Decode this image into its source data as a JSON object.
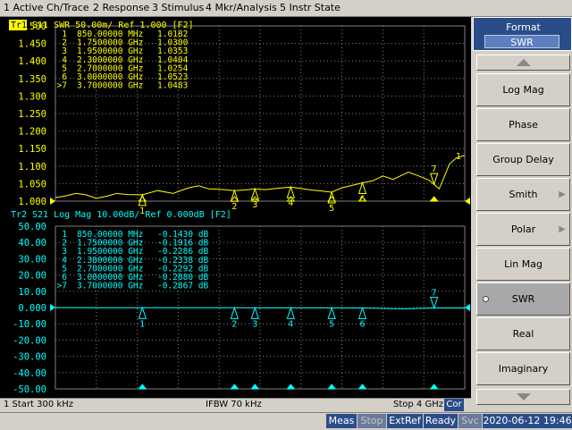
{
  "menu": [
    "1 Active Ch/Trace",
    "2 Response",
    "3 Stimulus",
    "4 Mkr/Analysis",
    "5 Instr State"
  ],
  "colors": {
    "trace1": "#ffff00",
    "trace2": "#00ffff",
    "grid": "#808080",
    "marker": "#ffff00"
  },
  "trace1": {
    "tag": "Tr1",
    "header": "S11  SWR 50.00m/ Ref 1.000 [F2]",
    "yticks": [
      "1.500",
      "1.450",
      "1.400",
      "1.350",
      "1.300",
      "1.250",
      "1.200",
      "1.150",
      "1.100",
      "1.050",
      "1.000"
    ],
    "markers": [
      {
        "id": "1",
        "freq": "850.00000 MHz",
        "val": "1.0182"
      },
      {
        "id": "2",
        "freq": "1.7500000 GHz",
        "val": "1.0300"
      },
      {
        "id": "3",
        "freq": "1.9500000 GHz",
        "val": "1.0353"
      },
      {
        "id": "4",
        "freq": "2.3000000 GHz",
        "val": "1.0404"
      },
      {
        "id": "5",
        "freq": "2.7000000 GHz",
        "val": "1.0254"
      },
      {
        "id": "6",
        "freq": "3.0000000 GHz",
        "val": "1.0523"
      },
      {
        "id": ">7",
        "freq": "3.7000000 GHz",
        "val": "1.0483"
      }
    ],
    "end_label": "1"
  },
  "trace2": {
    "tag": "Tr2",
    "header": "S21  Log Mag 10.00dB/ Ref 0.000dB [F2]",
    "yticks": [
      "50.00",
      "40.00",
      "30.00",
      "20.00",
      "10.00",
      "0.000",
      "-10.00",
      "-20.00",
      "-30.00",
      "-40.00",
      "-50.00"
    ],
    "markers": [
      {
        "id": "1",
        "freq": "850.00000 MHz",
        "val": "-0.1430 dB"
      },
      {
        "id": "2",
        "freq": "1.7500000 GHz",
        "val": "-0.1916 dB"
      },
      {
        "id": "3",
        "freq": "1.9500000 GHz",
        "val": "-0.2286 dB"
      },
      {
        "id": "4",
        "freq": "2.3000000 GHz",
        "val": "-0.2338 dB"
      },
      {
        "id": "5",
        "freq": "2.7000000 GHz",
        "val": "-0.2292 dB"
      },
      {
        "id": "6",
        "freq": "3.0000000 GHz",
        "val": "-0.2880 dB"
      },
      {
        "id": ">7",
        "freq": "3.7000000 GHz",
        "val": "-0.2867 dB"
      }
    ]
  },
  "chart_data": {
    "type": "line",
    "x_start_ghz": 0.0003,
    "x_stop_ghz": 4.0,
    "series": [
      {
        "name": "S11",
        "ylim": [
          1.0,
          1.5
        ],
        "points": [
          [
            0.0003,
            1.01
          ],
          [
            0.1,
            1.015
          ],
          [
            0.2,
            1.022
          ],
          [
            0.3,
            1.018
          ],
          [
            0.4,
            1.008
          ],
          [
            0.5,
            1.014
          ],
          [
            0.6,
            1.022
          ],
          [
            0.7,
            1.019
          ],
          [
            0.85,
            1.0182
          ],
          [
            1.0,
            1.03
          ],
          [
            1.15,
            1.022
          ],
          [
            1.3,
            1.038
          ],
          [
            1.4,
            1.044
          ],
          [
            1.5,
            1.035
          ],
          [
            1.6,
            1.034
          ],
          [
            1.75,
            1.03
          ],
          [
            1.85,
            1.032
          ],
          [
            1.95,
            1.0353
          ],
          [
            2.05,
            1.033
          ],
          [
            2.15,
            1.036
          ],
          [
            2.3,
            1.0404
          ],
          [
            2.4,
            1.036
          ],
          [
            2.5,
            1.032
          ],
          [
            2.6,
            1.029
          ],
          [
            2.7,
            1.0254
          ],
          [
            2.8,
            1.038
          ],
          [
            2.9,
            1.045
          ],
          [
            3.0,
            1.0523
          ],
          [
            3.1,
            1.058
          ],
          [
            3.2,
            1.072
          ],
          [
            3.3,
            1.062
          ],
          [
            3.45,
            1.083
          ],
          [
            3.55,
            1.072
          ],
          [
            3.65,
            1.06
          ],
          [
            3.7,
            1.0483
          ],
          [
            3.75,
            1.035
          ],
          [
            3.85,
            1.105
          ],
          [
            3.92,
            1.124
          ],
          [
            4.0,
            1.13
          ]
        ]
      },
      {
        "name": "S21",
        "ylim": [
          -50,
          50
        ],
        "points": [
          [
            0.0003,
            -0.05
          ],
          [
            0.85,
            -0.143
          ],
          [
            1.75,
            -0.1916
          ],
          [
            1.95,
            -0.2286
          ],
          [
            2.3,
            -0.2338
          ],
          [
            2.7,
            -0.2292
          ],
          [
            3.0,
            -0.288
          ],
          [
            3.4,
            -0.8
          ],
          [
            3.7,
            -0.2867
          ],
          [
            4.0,
            -0.3
          ]
        ]
      }
    ],
    "marker_x_ghz": [
      0.85,
      1.75,
      1.95,
      2.3,
      2.7,
      3.0,
      3.7
    ]
  },
  "bottom": {
    "start": "1  Start 300 kHz",
    "ifbw": "IFBW 70 kHz",
    "stop": "Stop 4 GHz",
    "cor": "Cor"
  },
  "softkeys": {
    "title": "Format",
    "current": "SWR",
    "items": [
      {
        "label": "Log Mag"
      },
      {
        "label": "Phase"
      },
      {
        "label": "Group Delay"
      },
      {
        "label": "Smith"
      },
      {
        "label": "Polar"
      },
      {
        "label": "Lin Mag"
      },
      {
        "label": "SWR"
      },
      {
        "label": "Real"
      },
      {
        "label": "Imaginary"
      }
    ]
  },
  "status": {
    "meas": "Meas",
    "stop": "Stop",
    "extref": "ExtRef",
    "ready": "Ready",
    "svc": "Svc",
    "datetime": "2020-06-12 19:46"
  }
}
